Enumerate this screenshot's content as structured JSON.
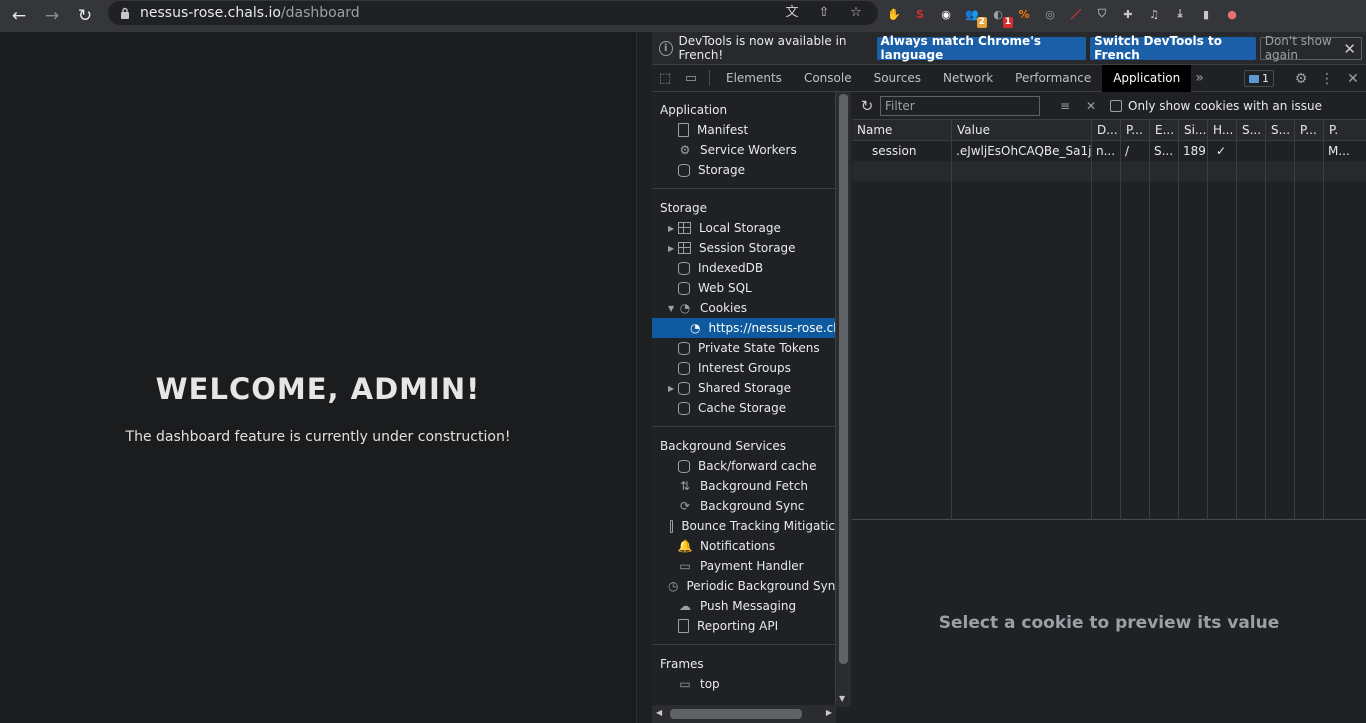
{
  "browser": {
    "url_host": "nessus-rose.chals.io",
    "url_path": "/dashboard",
    "extensions": [
      {
        "name": "ublock-icon",
        "color": "#c62828",
        "glyph": "✋",
        "badge": ""
      },
      {
        "name": "s-extension-icon",
        "color": "#d32f2f",
        "glyph": "S",
        "badge": ""
      },
      {
        "name": "shopping-icon",
        "color": "#ffffff",
        "glyph": "◉",
        "badge": ""
      },
      {
        "name": "user-groups-icon",
        "color": "#9aa0a6",
        "glyph": "👥",
        "badge": "2"
      },
      {
        "name": "globe-icon",
        "color": "#9aa0a6",
        "glyph": "◐",
        "badge": "1"
      },
      {
        "name": "wappalyzer-icon",
        "color": "#f57c00",
        "glyph": "%",
        "badge": ""
      },
      {
        "name": "mask-icon",
        "color": "#9aa0a6",
        "glyph": "◎",
        "badge": ""
      },
      {
        "name": "dropper-icon",
        "color": "#e53935",
        "glyph": "／",
        "badge": ""
      },
      {
        "name": "shield-icon",
        "color": "#9aa0a6",
        "glyph": "⛉",
        "badge": ""
      },
      {
        "name": "puzzle-icon",
        "color": "#c8c8c8",
        "glyph": "✚",
        "badge": ""
      },
      {
        "name": "media-icon",
        "color": "#c8c8c8",
        "glyph": "♫",
        "badge": ""
      },
      {
        "name": "download-icon",
        "color": "#c8c8c8",
        "glyph": "⤓",
        "badge": ""
      },
      {
        "name": "sidepanel-icon",
        "color": "#c8c8c8",
        "glyph": "▮",
        "badge": ""
      },
      {
        "name": "profile-avatar-icon",
        "color": "#e57373",
        "glyph": "●",
        "badge": ""
      }
    ]
  },
  "page": {
    "welcome": "WELCOME, ADMIN!",
    "message": "The dashboard feature is currently under construction!"
  },
  "devtools": {
    "infobar": {
      "text": "DevTools is now available in French!",
      "btn_match": "Always match Chrome's language",
      "btn_switch": "Switch DevTools to French",
      "btn_dismiss": "Don't show again"
    },
    "tabs": [
      "Elements",
      "Console",
      "Sources",
      "Network",
      "Performance",
      "Application"
    ],
    "active_tab": "Application",
    "issues_count": "1",
    "sidebar": {
      "application": {
        "title": "Application",
        "items": [
          "Manifest",
          "Service Workers",
          "Storage"
        ]
      },
      "storage": {
        "title": "Storage",
        "items": [
          "Local Storage",
          "Session Storage",
          "IndexedDB",
          "Web SQL",
          "Cookies"
        ],
        "cookie_child": "https://nessus-rose.cha",
        "items_after": [
          "Private State Tokens",
          "Interest Groups",
          "Shared Storage",
          "Cache Storage"
        ]
      },
      "background": {
        "title": "Background Services",
        "items": [
          "Back/forward cache",
          "Background Fetch",
          "Background Sync",
          "Bounce Tracking Mitigatic",
          "Notifications",
          "Payment Handler",
          "Periodic Background Sync",
          "Push Messaging",
          "Reporting API"
        ]
      },
      "frames": {
        "title": "Frames",
        "items": [
          "top"
        ]
      }
    },
    "cookies": {
      "filter_placeholder": "Filter",
      "only_issues_label": "Only show cookies with an issue",
      "columns": [
        "Name",
        "Value",
        "D...",
        "P...",
        "E...",
        "Si...",
        "H...",
        "S...",
        "S...",
        "P...",
        "P."
      ],
      "rows": [
        [
          "session",
          ".eJwljEsOhCAQBe_Sa1j...",
          "n...",
          "/",
          "S...",
          "189",
          "✓",
          "",
          "",
          "",
          "M..."
        ]
      ],
      "preview_text": "Select a cookie to preview its value"
    }
  }
}
